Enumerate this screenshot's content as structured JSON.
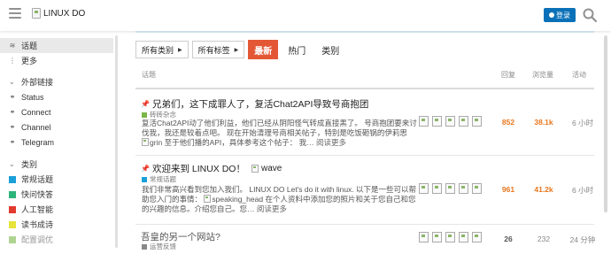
{
  "header": {
    "logo_alt": "LINUX DO",
    "login_label": "登录"
  },
  "sidebar": {
    "items": [
      {
        "label": "话题",
        "icon": "layers-icon",
        "active": true
      },
      {
        "label": "更多",
        "icon": "more-icon",
        "active": false
      }
    ],
    "links_section": "外部链接",
    "links": [
      {
        "label": "Status",
        "icon": "link-icon"
      },
      {
        "label": "Connect",
        "icon": "link-icon"
      },
      {
        "label": "Channel",
        "icon": "link-icon"
      },
      {
        "label": "Telegram",
        "icon": "link-icon"
      }
    ],
    "categories_section": "类别",
    "categories": [
      {
        "label": "常规话题",
        "color": "#1a9fd9"
      },
      {
        "label": "快问快答",
        "color": "#2cb57a"
      },
      {
        "label": "人工智能",
        "color": "#e23a2e"
      },
      {
        "label": "读书成诗",
        "color": "#e7e33b"
      },
      {
        "label": "配置调优",
        "color": "#7ab648"
      }
    ]
  },
  "nav": {
    "category_dropdown": "所有类别",
    "tag_dropdown": "所有标签",
    "tabs": [
      "最新",
      "热门",
      "类别"
    ]
  },
  "columns": {
    "topic": "话题",
    "replies": "回复",
    "views": "浏览量",
    "activity": "活动"
  },
  "topics": [
    {
      "title": "兄弟们，这下成罪人了，复活Chat2API导致号商抱团",
      "category": "砖砖杂念",
      "category_color": "#7ab648",
      "excerpt_1": "复活Chat2API动了他们利益，他们已经从阴阳怪气转成直接黑了。 号商抱团要来讨",
      "excerpt_2": "伐我，我还是较着点吧。 现在开始清理号商相关帖子，特别是吃饭砸锅的伊莉思",
      "excerpt_img": "grin",
      "excerpt_3": "至于他们播的API，具体参考这个帖子：  我… ",
      "more": "阅读更多",
      "replies": "852",
      "views": "38.1k",
      "activity": "6 小时"
    },
    {
      "title": "欢迎来到 LINUX DO！",
      "title_img": "wave",
      "category": "常规话题",
      "category_color": "#1a9fd9",
      "excerpt_1": "我们非常高兴看到您加入我们。 LINUX DO Let's do it with linux. 以下是一些可以帮",
      "excerpt_2a": "助您入门的事情：",
      "excerpt_img": "speaking_head",
      "excerpt_2b": "在个人资料中添加您的照片和关于您自己和您",
      "excerpt_3": "的兴趣的信息。介绍您自己。您… ",
      "more": "阅读更多",
      "replies": "961",
      "views": "41.2k",
      "activity": "6 小时"
    },
    {
      "title": "吾皇的另一个网站?",
      "category": "运营反馈",
      "category_color": "#888888",
      "replies": "26",
      "views": "232",
      "activity": "24 分钟"
    }
  ]
}
